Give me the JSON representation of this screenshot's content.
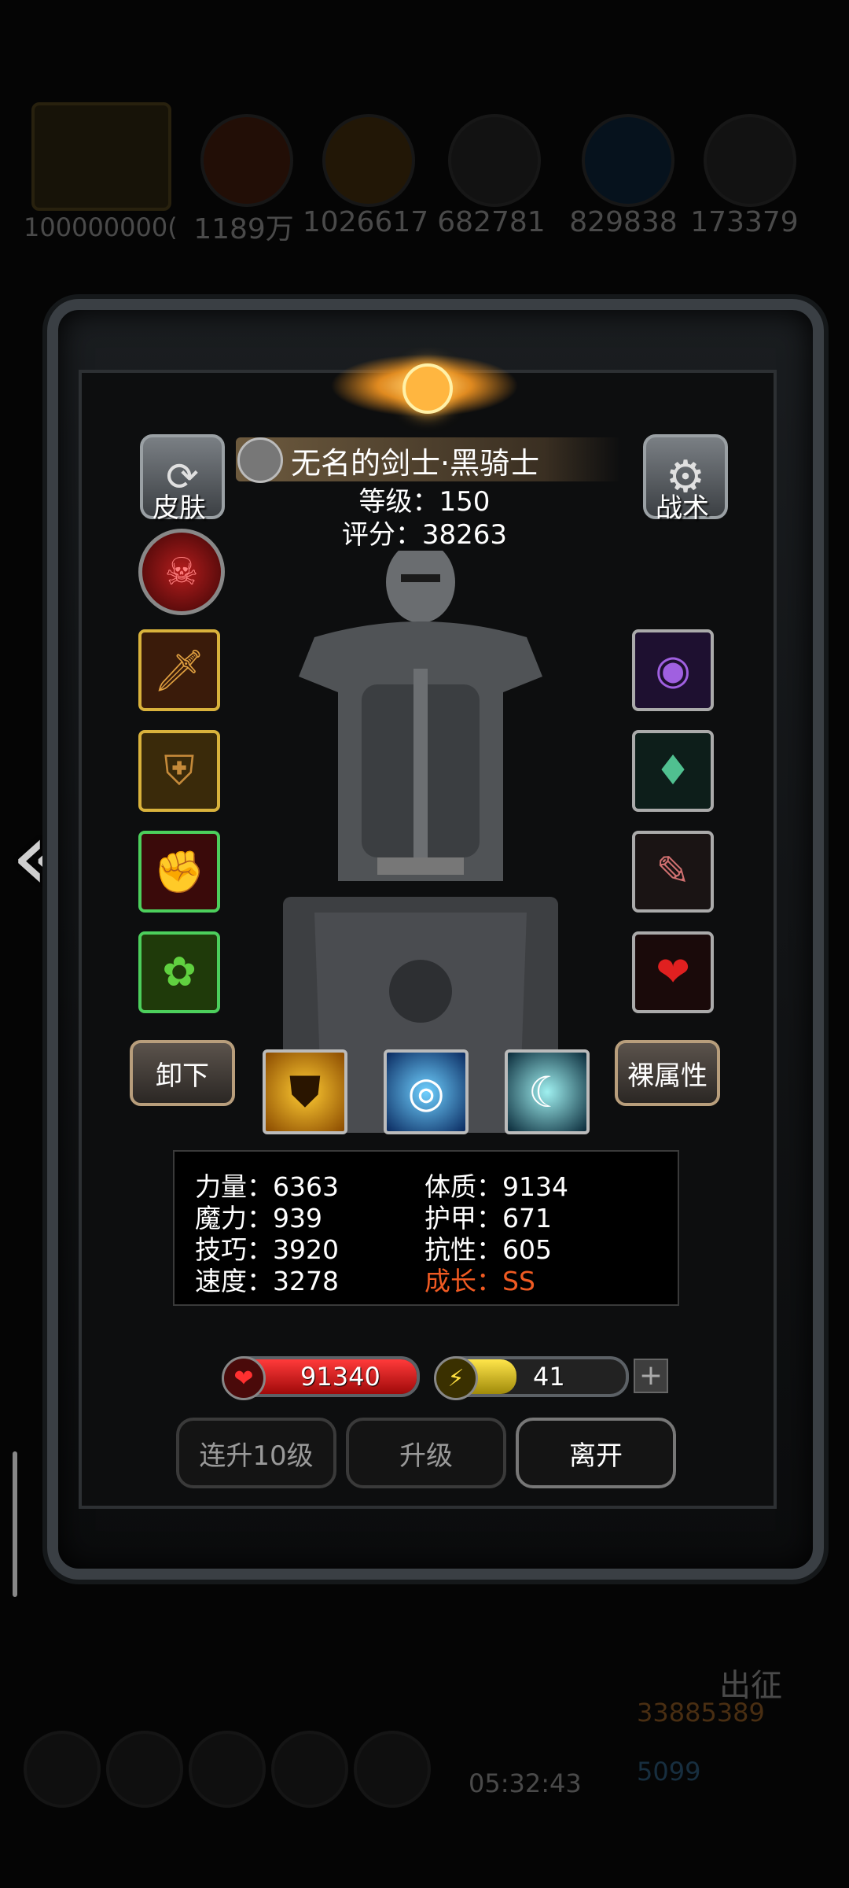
{
  "background": {
    "resources": [
      "100000000(",
      "1189万",
      "1026617",
      "682781",
      "829838",
      "173379"
    ],
    "side_label": "出征",
    "gold": "33885389",
    "gems": "5099",
    "timer": "05:32:43"
  },
  "panel": {
    "skin_button": "皮肤",
    "tactics_button": "战术",
    "hero_name": "无名的剑士·黑骑士",
    "level_text": "等级：150",
    "score_text": "评分：38263",
    "unequip_button": "卸下",
    "base_attr_button": "裸属性",
    "left_slots": [
      "sword-icon",
      "armor-icon",
      "gauntlet-icon",
      "trinket-icon"
    ],
    "right_slots": [
      "dark-orb-icon",
      "crystal-icon",
      "feather-icon",
      "heart-gem-icon"
    ],
    "skills": [
      "shield-flame-icon",
      "eye-icon",
      "slash-icon"
    ],
    "stats": {
      "strength": "力量：6363",
      "constitution": "体质：9134",
      "magic": "魔力：939",
      "armor": "护甲：671",
      "skill": "技巧：3920",
      "resistance": "抗性：605",
      "speed": "速度：3278",
      "growth": "成长：SS"
    },
    "hp": {
      "value": "91340",
      "fill": 1.0
    },
    "energy": {
      "value": "41",
      "fill": 0.41
    },
    "plus": "+",
    "buttons": {
      "level10": "连升10级",
      "level_up": "升级",
      "leave": "离开"
    }
  },
  "colors": {
    "hp": "#d1161d",
    "energy": "#e5c31a",
    "growth": "#f05a22"
  }
}
